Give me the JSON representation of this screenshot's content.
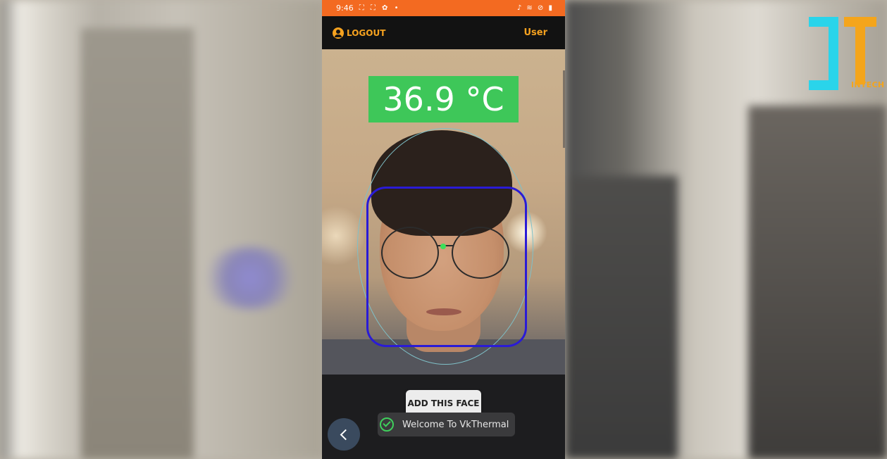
{
  "status_bar": {
    "time": "9:46",
    "left_icons": "⛶ ⛶ ✿ •",
    "right_icons": "♪ ≋ ⊘ ▮"
  },
  "app_bar": {
    "logout_label": "LOGOUT",
    "user_label": "User"
  },
  "camera": {
    "temperature": "36.9 °C"
  },
  "actions": {
    "add_face_label": "ADD THIS FACE"
  },
  "toast": {
    "message": "Welcome To VkThermal"
  },
  "logo": {
    "text": "INTECH"
  },
  "colors": {
    "status_bar": "#f36a21",
    "accent": "#f6a21f",
    "temp_ok": "#3ec759",
    "face_box": "#2a1bd6"
  }
}
